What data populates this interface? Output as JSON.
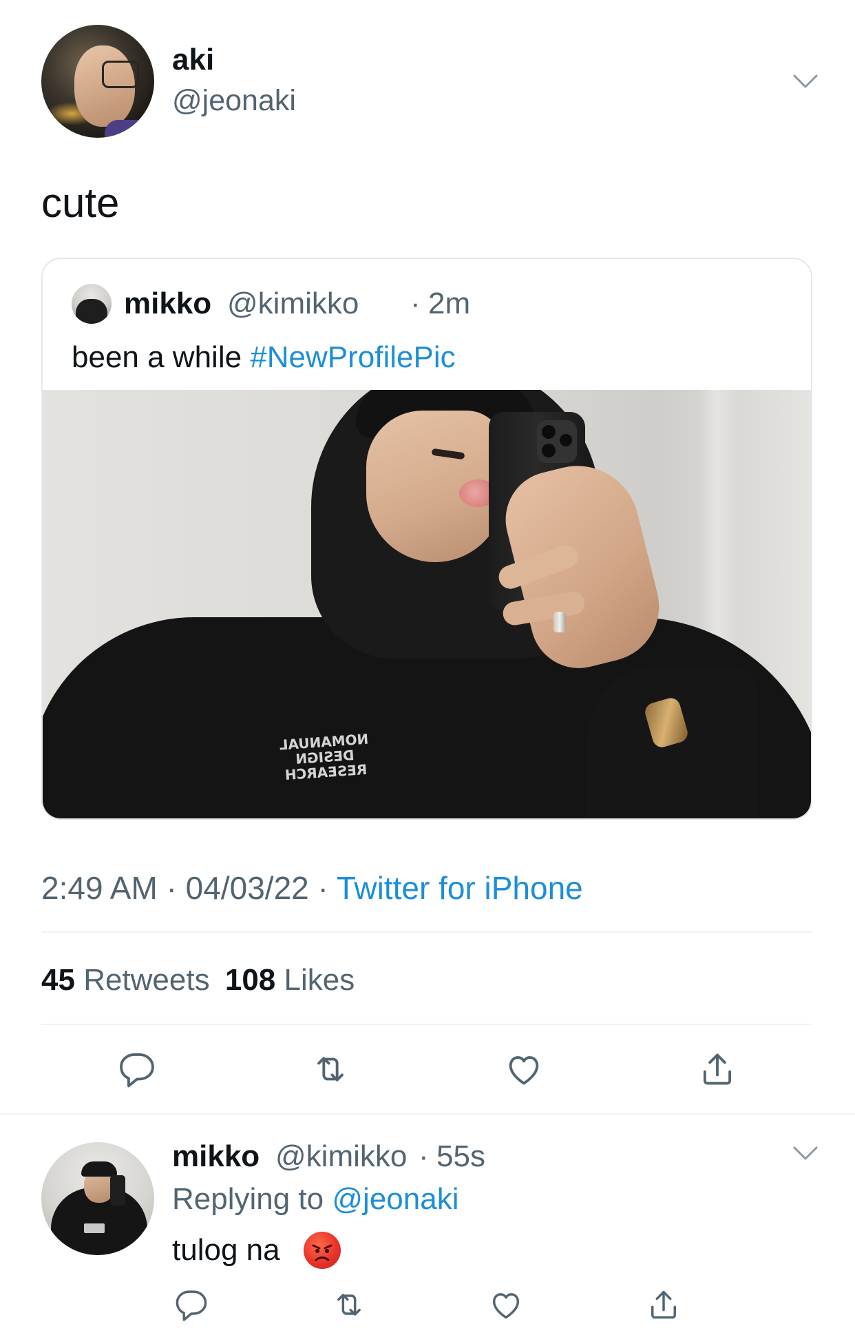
{
  "main_tweet": {
    "author_name": "aki",
    "author_handle": "@jeonaki",
    "text": "cute",
    "timestamp_time": "2:49 AM",
    "timestamp_date": "04/03/22",
    "source": "Twitter for iPhone",
    "separator": "·"
  },
  "quoted_tweet": {
    "author_name": "mikko",
    "author_handle": "@kimikko",
    "separator": "·",
    "time": "2m",
    "text_plain": "been a while ",
    "hashtag": "#NewProfilePic",
    "hoodie_print": "NOMANUAL DESIGN RESEARCH"
  },
  "stats": {
    "retweets_count": "45",
    "retweets_label": "Retweets",
    "likes_count": "108",
    "likes_label": "Likes"
  },
  "reply": {
    "author_name": "mikko",
    "author_handle": "@kimikko",
    "separator": "·",
    "time": "55s",
    "replying_label": "Replying to",
    "replying_handle": "@jeonaki",
    "text": "tulog na"
  },
  "icons": {
    "reply": "reply-icon",
    "retweet": "retweet-icon",
    "like": "heart-icon",
    "share": "share-icon",
    "more": "chevron-down-icon",
    "emoji": "angry-face-emoji"
  },
  "colors": {
    "link": "#1d8ed8",
    "muted": "#536471",
    "text": "#0f1419",
    "divider": "#eff3f4"
  }
}
